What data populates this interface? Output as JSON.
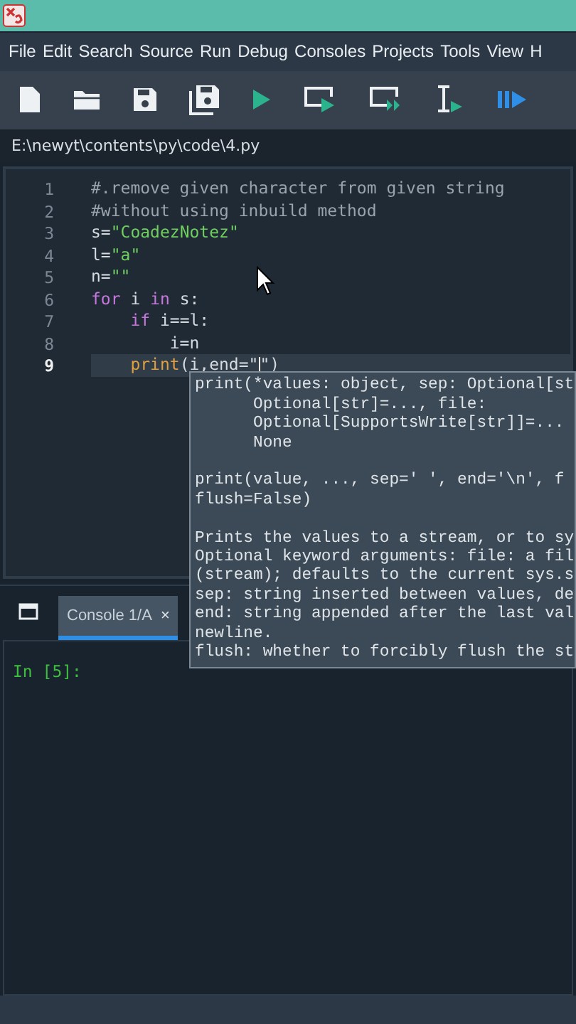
{
  "menu": [
    "File",
    "Edit",
    "Search",
    "Source",
    "Run",
    "Debug",
    "Consoles",
    "Projects",
    "Tools",
    "View",
    "H"
  ],
  "file_path": "E:\\newyt\\contents\\py\\code\\4.py",
  "editor": {
    "lines": [
      {
        "number": "1",
        "current": false,
        "tokens": [
          {
            "kind": "comment",
            "text": "#.remove given character from given string"
          }
        ]
      },
      {
        "number": "2",
        "current": false,
        "tokens": [
          {
            "kind": "comment",
            "text": "#without using inbuild method"
          }
        ]
      },
      {
        "number": "3",
        "current": false,
        "tokens": [
          {
            "kind": "plain",
            "text": "s="
          },
          {
            "kind": "string",
            "text": "\"CoadezNotez\""
          }
        ]
      },
      {
        "number": "4",
        "current": false,
        "tokens": [
          {
            "kind": "plain",
            "text": "l="
          },
          {
            "kind": "string",
            "text": "\"a\""
          }
        ]
      },
      {
        "number": "5",
        "current": false,
        "tokens": [
          {
            "kind": "plain",
            "text": "n="
          },
          {
            "kind": "string",
            "text": "\"\""
          }
        ]
      },
      {
        "number": "6",
        "current": false,
        "tokens": [
          {
            "kind": "keyword",
            "text": "for"
          },
          {
            "kind": "plain",
            "text": " i "
          },
          {
            "kind": "keyword",
            "text": "in"
          },
          {
            "kind": "plain",
            "text": " s:"
          }
        ]
      },
      {
        "number": "7",
        "current": false,
        "tokens": [
          {
            "kind": "keyword",
            "text": "    if"
          },
          {
            "kind": "plain",
            "text": " i==l:"
          }
        ]
      },
      {
        "number": "8",
        "current": false,
        "tokens": [
          {
            "kind": "plain",
            "text": "        i=n"
          }
        ]
      },
      {
        "number": "9",
        "current": true,
        "tokens": [
          {
            "kind": "builtin",
            "text": "    print"
          },
          {
            "kind": "plain",
            "text": "(i,end=\""
          },
          {
            "kind": "caret"
          },
          {
            "kind": "plain",
            "text": "\")"
          }
        ]
      }
    ]
  },
  "tooltip": {
    "blocks": [
      [
        "print(*values: object, sep: Optional[st",
        "      Optional[str]=..., file:",
        "      Optional[SupportsWrite[str]]=...",
        "      None"
      ],
      [
        "print(value, ..., sep=' ', end='\\n', f",
        "flush=False)"
      ],
      [
        "Prints the values to a stream, or to sy",
        "Optional keyword arguments: file: a fil",
        "(stream); defaults to the current sys.s",
        "sep: string inserted between values, de",
        "end: string appended after the last val",
        "newline.",
        "flush: whether to forcibly flush the st"
      ]
    ]
  },
  "console": {
    "tabs": [
      {
        "label": "Console 1/A",
        "close": "×",
        "selected": true
      }
    ],
    "prompt": "In [5]:"
  }
}
